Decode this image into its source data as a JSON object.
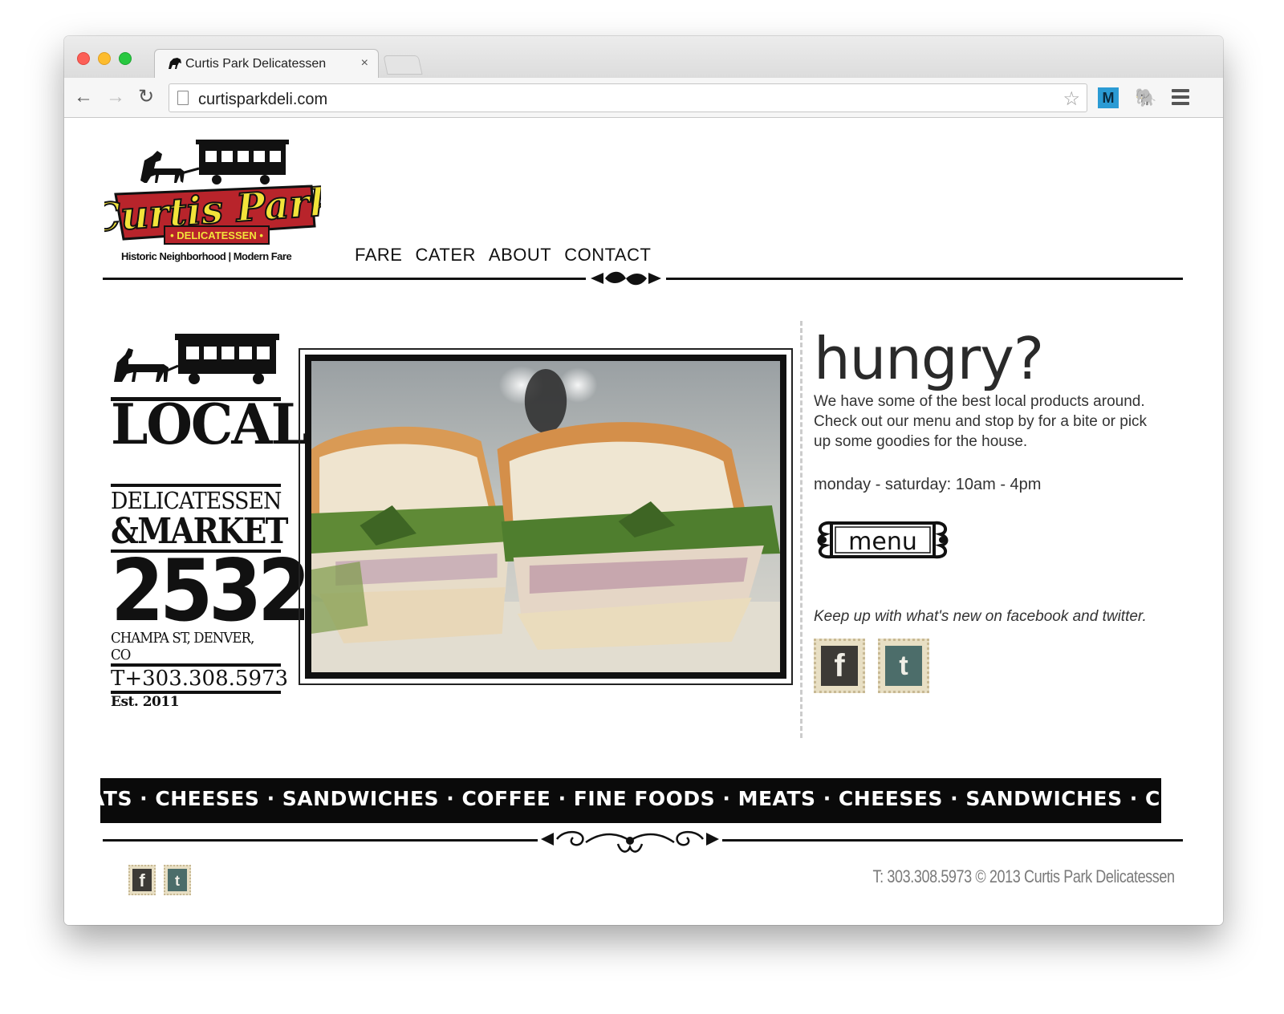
{
  "browser": {
    "tab_title": "Curtis Park Delicatessen",
    "tab_close": "×",
    "url": "curtisparkdeli.com",
    "extension_label": "M"
  },
  "site": {
    "logo": {
      "name": "Curtis Park",
      "sub": "• DELICATESSEN •",
      "tagline": "Historic Neighborhood | Modern Fare"
    },
    "nav": [
      "FARE",
      "CATER",
      "ABOUT",
      "CONTACT"
    ],
    "left": {
      "local": "LOCAL",
      "deli": "DELICATESSEN",
      "market": "&MARKET",
      "number": "2532",
      "address": "CHAMPA ST, DENVER, CO",
      "phone": "T+303.308.5973",
      "est": "Est. 2011"
    },
    "right": {
      "heading": "hungry?",
      "intro": "We have some of the best local products around. Check out our menu and stop by for a bite or pick up some goodies for the house.",
      "hours": "monday - saturday: 10am - 4pm",
      "menu_button": "menu",
      "social_text": "Keep up with what's new on facebook and twitter.",
      "facebook_glyph": "f",
      "twitter_glyph": "t"
    },
    "banner": "ATS · CHEESES · SANDWICHES · COFFEE · FINE FOODS · MEATS · CHEESES · SANDWICHES · COFFEE · FINE FOODS",
    "footer": {
      "copyright": "T: 303.308.5973 © 2013 Curtis Park Delicatessen"
    }
  },
  "colors": {
    "logo_red": "#b8242b",
    "logo_yellow": "#f2e33a",
    "text_dark": "#111111",
    "footer_gray": "#7a7a7a"
  }
}
